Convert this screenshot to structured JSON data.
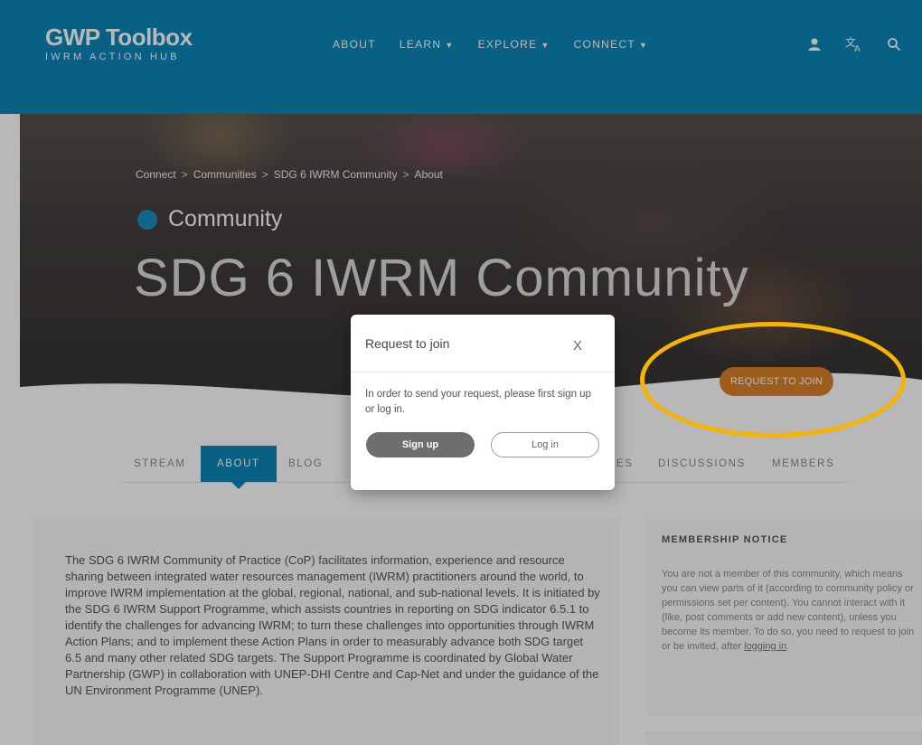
{
  "header": {
    "logo_title": "GWP Toolbox",
    "logo_subtitle": "IWRM ACTION HUB",
    "nav": [
      {
        "label": "ABOUT"
      },
      {
        "label": "LEARN"
      },
      {
        "label": "EXPLORE"
      },
      {
        "label": "CONNECT"
      }
    ],
    "icons": [
      "user-icon",
      "translate-icon",
      "search-icon"
    ],
    "color": "#0c86b8"
  },
  "hero": {
    "breadcrumb": [
      "Connect",
      "Communities",
      "SDG 6 IWRM Community",
      "About"
    ],
    "breadcrumb_separator": ">",
    "type_label": "Community",
    "title": "SDG 6 IWRM Community",
    "join_button": "REQUEST TO JOIN",
    "join_color": "#d9822b"
  },
  "tabs": {
    "items": [
      "STREAM",
      "ABOUT",
      "BLOG",
      "ES",
      "DISCUSSIONS",
      "MEMBERS"
    ],
    "active": "ABOUT"
  },
  "main": {
    "description": "The SDG 6 IWRM Community of Practice (CoP) facilitates information, experience and resource sharing between integrated water resources management (IWRM) practitioners around the world, to improve IWRM implementation at the global, regional, national, and sub-national levels. It is initiated by the SDG 6 IWRM Support Programme, which assists countries in reporting on SDG indicator 6.5.1 to identify the challenges for advancing IWRM; to turn these challenges into opportunities through IWRM Action Plans; and to implement these Action Plans in order to measurably advance both SDG target 6.5 and many other related SDG targets. The Support Programme is coordinated by Global Water Partnership (GWP) in collaboration with UNEP-DHI Centre and Cap-Net and under the guidance of the UN Environment Programme (UNEP)."
  },
  "sidebar": {
    "title": "MEMBERSHIP NOTICE",
    "notice": "You are not a member of this community, which means you can view parts of it (according to community policy or permissions set per content). You cannot interact with it (like, post comments or add new content), unless you become its member. To do so, you need to request to join or be invited, after",
    "link": "logging in",
    "after_link": "."
  },
  "modal": {
    "title": "Request to join",
    "close": "X",
    "message": "In order to send your request, please first sign up or log in.",
    "signup": "Sign up",
    "login": "Log in"
  },
  "annotation": {
    "highlight_color": "#f6b400"
  }
}
